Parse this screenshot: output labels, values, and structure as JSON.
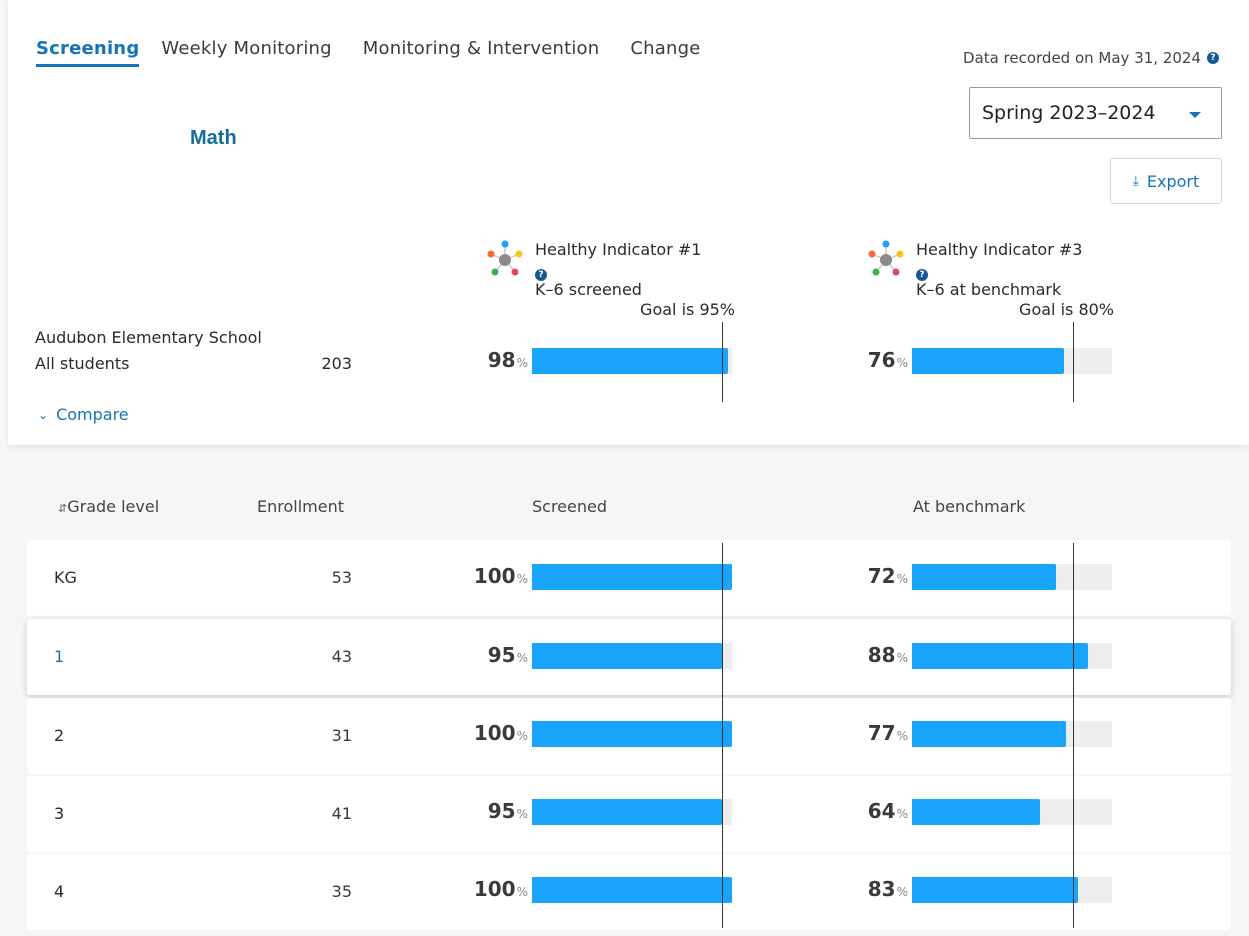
{
  "tabs": [
    "Screening",
    "Weekly Monitoring",
    "Monitoring & Intervention",
    "Change"
  ],
  "active_tab": "Screening",
  "recorded_text": "Data recorded on May 31, 2024",
  "season_select": {
    "value": "Spring 2023–2024"
  },
  "export_label": "Export",
  "subject": "Math",
  "indicators": [
    {
      "title": "Healthy Indicator #1",
      "desc": "K–6 screened",
      "goal": "Goal is 95%"
    },
    {
      "title": "Healthy Indicator #3",
      "desc": "K–6 at benchmark",
      "goal": "Goal is 80%"
    }
  ],
  "school": {
    "name": "Audubon Elementary School",
    "group": "All students",
    "count": "203",
    "screened_pct": "98",
    "benchmark_pct": "76",
    "screened_value": 98,
    "benchmark_value": 76
  },
  "compare_label": "Compare",
  "columns": {
    "grade": "Grade level",
    "enrollment": "Enrollment",
    "screened": "Screened",
    "benchmark": "At benchmark"
  },
  "pct_unit": "%",
  "goals": {
    "screened": 95,
    "benchmark": 80
  },
  "rows": [
    {
      "grade": "KG",
      "enrollment": "53",
      "screened": "100",
      "benchmark": "72",
      "screened_value": 100,
      "benchmark_value": 72
    },
    {
      "grade": "1",
      "enrollment": "43",
      "screened": "95",
      "benchmark": "88",
      "screened_value": 95,
      "benchmark_value": 88
    },
    {
      "grade": "2",
      "enrollment": "31",
      "screened": "100",
      "benchmark": "77",
      "screened_value": 100,
      "benchmark_value": 77
    },
    {
      "grade": "3",
      "enrollment": "41",
      "screened": "95",
      "benchmark": "64",
      "screened_value": 95,
      "benchmark_value": 64
    },
    {
      "grade": "4",
      "enrollment": "35",
      "screened": "100",
      "benchmark": "83",
      "screened_value": 100,
      "benchmark_value": 83
    }
  ],
  "colors": {
    "accent": "#1673b8",
    "bar": "#1aa3fb",
    "track": "#eeeeee",
    "subject": "#176b9a"
  }
}
